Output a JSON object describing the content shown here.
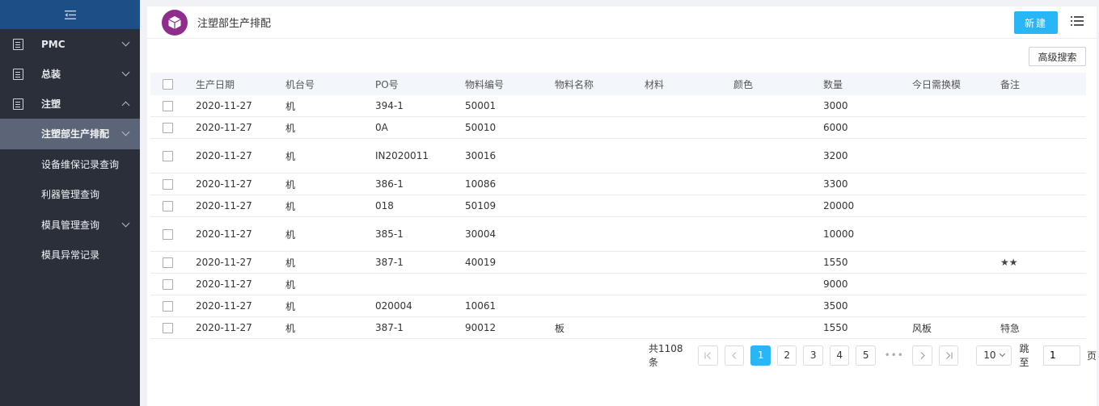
{
  "sidebar": {
    "collapse_icon": "menu-fold-icon",
    "items": [
      {
        "label": "PMC",
        "icon": "document-icon",
        "expanded": false
      },
      {
        "label": "总装",
        "icon": "document-icon",
        "expanded": false
      },
      {
        "label": "注塑",
        "icon": "document-icon",
        "expanded": true
      }
    ],
    "sub_items": [
      {
        "label": "注塑部生产排配",
        "active": true,
        "has_children": true
      },
      {
        "label": "设备维保记录查询",
        "active": false,
        "has_children": false
      },
      {
        "label": "利器管理查询",
        "active": false,
        "has_children": false
      },
      {
        "label": "模具管理查询",
        "active": false,
        "has_children": true
      },
      {
        "label": "模具异常记录",
        "active": false,
        "has_children": false
      }
    ]
  },
  "header": {
    "title": "注塑部生产排配",
    "logo_icon": "cube-icon",
    "logo_color": "#8e2d8c",
    "new_label": "新建",
    "accent": "#29b6f6"
  },
  "toolbar": {
    "advanced_search_label": "高级搜索"
  },
  "table": {
    "columns": [
      "生产日期",
      "机台号",
      "PO号",
      "物料编号",
      "物料名称",
      "材料",
      "颜色",
      "数量",
      "今日需换模",
      "备注"
    ],
    "rows": [
      {
        "date": "2020-11-27",
        "machine": "机",
        "po": "394-1",
        "part_no": "50001",
        "part_name": "",
        "material": "",
        "color": "",
        "qty": "3000",
        "mold_change": "",
        "note": ""
      },
      {
        "date": "2020-11-27",
        "machine": "机",
        "po": "0A",
        "part_no": "50010",
        "part_name": "",
        "material": "",
        "color": "",
        "qty": "6000",
        "mold_change": "",
        "note": ""
      },
      {
        "date": "2020-11-27",
        "machine": "机",
        "po": "IN2020011",
        "part_no": "30016",
        "part_name": "",
        "material": "",
        "color": "",
        "qty": "3200",
        "mold_change": "",
        "note": ""
      },
      {
        "date": "2020-11-27",
        "machine": "机",
        "po": "386-1",
        "part_no": "10086",
        "part_name": "",
        "material": "",
        "color": "",
        "qty": "3300",
        "mold_change": "",
        "note": ""
      },
      {
        "date": "2020-11-27",
        "machine": "机",
        "po": "018",
        "part_no": "50109",
        "part_name": "",
        "material": "",
        "color": "",
        "qty": "20000",
        "mold_change": "",
        "note": ""
      },
      {
        "date": "2020-11-27",
        "machine": "机",
        "po": "385-1",
        "part_no": "30004",
        "part_name": "",
        "material": "",
        "color": "",
        "qty": "10000",
        "mold_change": "",
        "note": ""
      },
      {
        "date": "2020-11-27",
        "machine": "机",
        "po": "387-1",
        "part_no": "40019",
        "part_name": "",
        "material": "",
        "color": "",
        "qty": "1550",
        "mold_change": "",
        "note": "★★"
      },
      {
        "date": "2020-11-27",
        "machine": "机",
        "po": "",
        "part_no": "",
        "part_name": "",
        "material": "",
        "color": "",
        "qty": "9000",
        "mold_change": "",
        "note": ""
      },
      {
        "date": "2020-11-27",
        "machine": "机",
        "po": "020004",
        "part_no": "10061",
        "part_name": "",
        "material": "",
        "color": "",
        "qty": "3500",
        "mold_change": "",
        "note": ""
      },
      {
        "date": "2020-11-27",
        "machine": "机",
        "po": "387-1",
        "part_no": "90012",
        "part_name": "板",
        "material": "",
        "color": "",
        "qty": "1550",
        "mold_change": "风板",
        "note": "特急"
      }
    ]
  },
  "pagination": {
    "total_label": "共1108条",
    "pages": [
      "1",
      "2",
      "3",
      "4",
      "5"
    ],
    "current": "1",
    "ellipsis": "•••",
    "page_size": "10",
    "jump_label": "跳至",
    "jump_value": "1",
    "page_unit": "页"
  }
}
